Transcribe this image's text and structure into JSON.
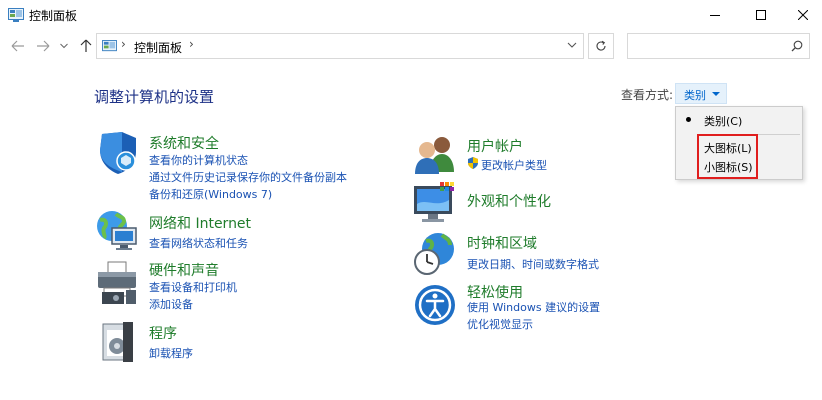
{
  "window": {
    "title": "控制面板",
    "icon": "control-panel-icon"
  },
  "address": {
    "breadcrumb": "控制面板",
    "separator": "›"
  },
  "search": {
    "placeholder": "",
    "value": ""
  },
  "page": {
    "heading": "调整计算机的设置",
    "view_by_label": "查看方式:",
    "view_by_value": "类别"
  },
  "categories": [
    {
      "name": "系统和安全",
      "icon": "shield-icon",
      "links": [
        "查看你的计算机状态",
        "通过文件历史记录保存你的文件备份副本",
        "备份和还原(Windows 7)"
      ]
    },
    {
      "name": "网络和 Internet",
      "icon": "network-globe-icon",
      "links": [
        "查看网络状态和任务"
      ]
    },
    {
      "name": "硬件和声音",
      "icon": "printer-icon",
      "links": [
        "查看设备和打印机",
        "添加设备"
      ]
    },
    {
      "name": "程序",
      "icon": "programs-icon",
      "links": [
        "卸载程序"
      ]
    },
    {
      "name": "用户帐户",
      "icon": "users-icon",
      "links": [
        "更改帐户类型"
      ]
    },
    {
      "name": "外观和个性化",
      "icon": "display-palette-icon",
      "links": []
    },
    {
      "name": "时钟和区域",
      "icon": "clock-globe-icon",
      "links": [
        "更改日期、时间或数字格式"
      ]
    },
    {
      "name": "轻松使用",
      "icon": "ease-of-access-icon",
      "links": [
        "使用 Windows 建议的设置",
        "优化视觉显示"
      ]
    }
  ],
  "view_menu": {
    "items": [
      {
        "label": "类别(C)",
        "selected": true
      },
      {
        "label": "大图标(L)",
        "selected": false
      },
      {
        "label": "小图标(S)",
        "selected": false
      }
    ],
    "highlight_color": "#e01e1e"
  },
  "colors": {
    "heading": "#1e3287",
    "category_title": "#1f7c2b",
    "link": "#1a52b3",
    "accent": "#0066cc"
  }
}
